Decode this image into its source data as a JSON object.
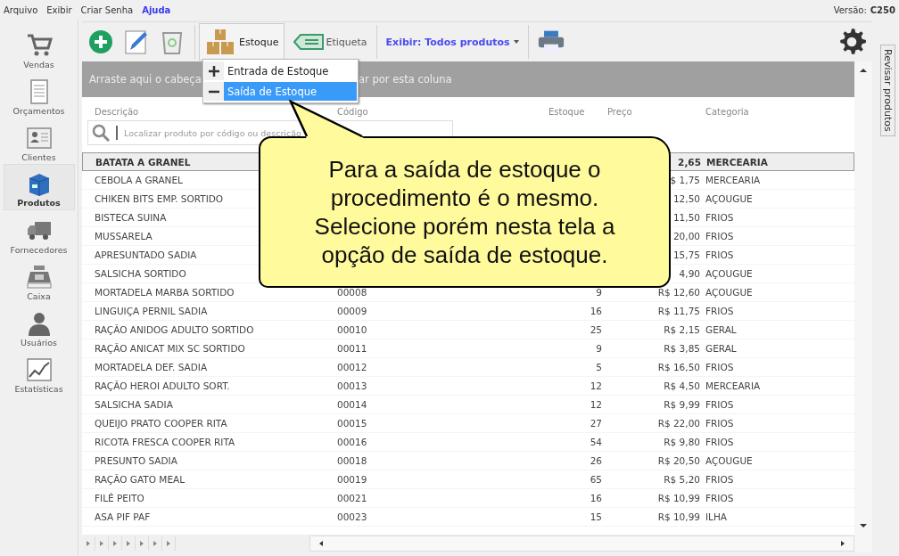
{
  "menu": [
    {
      "label": "Arquivo",
      "kind": "plain"
    },
    {
      "label": "Exibir",
      "kind": "plain"
    },
    {
      "label": "Criar Senha",
      "kind": "plain"
    },
    {
      "label": "Ajuda",
      "kind": "link"
    }
  ],
  "version": {
    "label": "Versão:",
    "value": "C250"
  },
  "sidebar": [
    {
      "label": "Vendas",
      "selected": false
    },
    {
      "label": "Orçamentos",
      "selected": false
    },
    {
      "label": "Clientes",
      "selected": false
    },
    {
      "label": "Produtos",
      "selected": true
    },
    {
      "label": "Fornecedores",
      "selected": false
    },
    {
      "label": "Caixa",
      "selected": false
    },
    {
      "label": "Usuários",
      "selected": false
    },
    {
      "label": "Estatísticas",
      "selected": false
    }
  ],
  "toolbar": {
    "stock_button": "Estoque",
    "label_button": "Etiqueta",
    "filter": "Exibir: Todos produtos"
  },
  "stock_menu": [
    {
      "label": "Entrada de Estoque",
      "selected": false
    },
    {
      "label": "Saída de Estoque",
      "selected": true
    }
  ],
  "group_bar": {
    "left": "Arraste aqui o cabeça",
    "right": "ar por esta coluna"
  },
  "columns": [
    "Descrição",
    "Código",
    "Estoque",
    "Preço",
    "Categoria"
  ],
  "search": {
    "placeholder": "Localizar produto por código ou descrição"
  },
  "rows": [
    {
      "description": "BATATA A GRANEL",
      "price": "2,65",
      "category": "MERCEARIA",
      "selected": true
    },
    {
      "description": "CEBOLA A GRANEL",
      "price": "$ 1,75",
      "category": "MERCEARIA",
      "selected": false
    },
    {
      "description": "CHIKEN BITS EMP. SORTIDO",
      "price": "12,50",
      "category": "AÇOUGUE",
      "selected": false
    },
    {
      "description": "BISTECA SUINA",
      "price": "11,50",
      "category": "FRIOS",
      "selected": false
    },
    {
      "description": "MUSSARELA",
      "price": "20,00",
      "category": "FRIOS",
      "selected": false
    },
    {
      "description": "APRESUNTADO SADIA",
      "price": "15,75",
      "category": "FRIOS",
      "selected": false
    },
    {
      "description": "SALSICHA  SORTIDO",
      "price": "4,90",
      "category": "AÇOUGUE",
      "selected": false
    },
    {
      "description": "MORTADELA MARBA SORTIDO",
      "code": "00008",
      "stock": "9",
      "price": "R$ 12,60",
      "category": "AÇOUGUE",
      "selected": false
    },
    {
      "description": "LINGUIÇA PERNIL SADIA",
      "code": "00009",
      "stock": "16",
      "price": "R$ 11,75",
      "category": "FRIOS",
      "selected": false
    },
    {
      "description": "RAÇÃO ANIDOG ADULTO SORTIDO",
      "code": "00010",
      "stock": "25",
      "price": "R$ 2,15",
      "category": "GERAL",
      "selected": false
    },
    {
      "description": "RAÇÃO ANICAT MIX SC SORTIDO",
      "code": "00011",
      "stock": "9",
      "price": "R$ 3,85",
      "category": "GERAL",
      "selected": false
    },
    {
      "description": "MORTADELA DEF. SADIA",
      "code": "00012",
      "stock": "5",
      "price": "R$ 16,50",
      "category": "FRIOS",
      "selected": false
    },
    {
      "description": "RAÇÃO HEROI ADULTO SORT.",
      "code": "00013",
      "stock": "12",
      "price": "R$ 4,50",
      "category": "MERCEARIA",
      "selected": false
    },
    {
      "description": "SALSICHA SADIA",
      "code": "00014",
      "stock": "12",
      "price": "R$ 9,99",
      "category": "FRIOS",
      "selected": false
    },
    {
      "description": "QUEIJO PRATO COOPER RITA",
      "code": "00015",
      "stock": "27",
      "price": "R$ 22,00",
      "category": "FRIOS",
      "selected": false
    },
    {
      "description": "RICOTA FRESCA COOPER RITA",
      "code": "00016",
      "stock": "54",
      "price": "R$ 9,80",
      "category": "FRIOS",
      "selected": false
    },
    {
      "description": "PRESUNTO  SADIA",
      "code": "00018",
      "stock": "26",
      "price": "R$ 20,50",
      "category": "AÇOUGUE",
      "selected": false
    },
    {
      "description": "RAÇÃO GATO MEAL",
      "code": "00019",
      "stock": "65",
      "price": "R$ 5,20",
      "category": "FRIOS",
      "selected": false
    },
    {
      "description": "FILÉ PEITO",
      "code": "00021",
      "stock": "16",
      "price": "R$ 10,99",
      "category": "FRIOS",
      "selected": false
    },
    {
      "description": "ASA PIF PAF",
      "code": "00023",
      "stock": "15",
      "price": "R$ 10,99",
      "category": "ILHA",
      "selected": false
    }
  ],
  "side_tab": "Revisar produtos",
  "callout": [
    "Para a saída de estoque o",
    "procedimento é o mesmo.",
    "Selecione porém nesta tela a",
    "opção de saída de estoque."
  ]
}
